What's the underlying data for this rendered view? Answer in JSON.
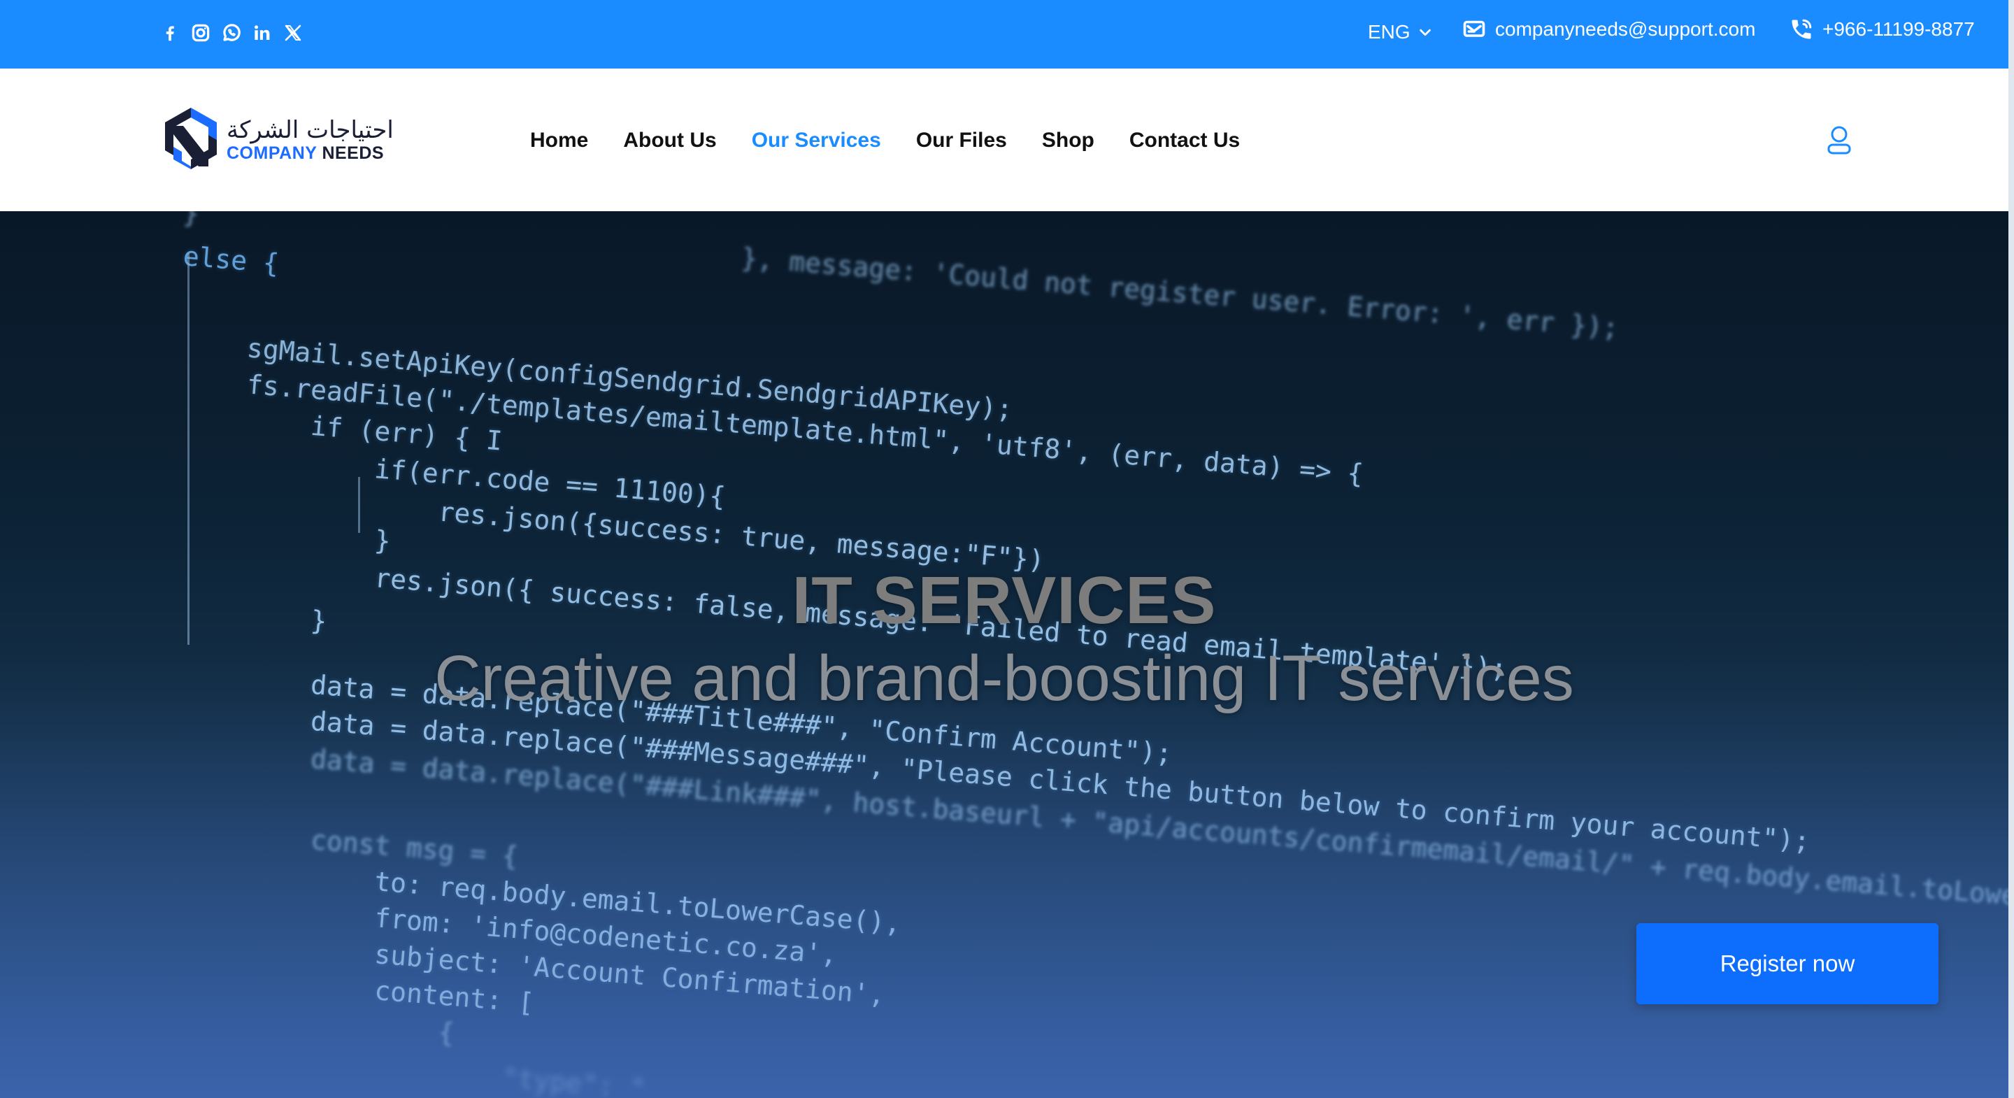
{
  "topbar": {
    "social_icons": [
      "facebook-icon",
      "instagram-icon",
      "whatsapp-icon",
      "linkedin-icon",
      "x-twitter-icon"
    ],
    "language": "ENG",
    "email": "companyneeds@support.com",
    "phone": "+966-11199-8877",
    "background_color": "#1b8cff"
  },
  "header": {
    "logo": {
      "arabic_text": "احتياجات الشركة",
      "company": "COMPANY",
      "needs": "NEEDS"
    },
    "nav": [
      {
        "label": "Home",
        "active": false
      },
      {
        "label": "About Us",
        "active": false
      },
      {
        "label": "Our Services",
        "active": true
      },
      {
        "label": "Our Files",
        "active": false
      },
      {
        "label": "Shop",
        "active": false
      },
      {
        "label": "Contact Us",
        "active": false
      }
    ],
    "accent_color": "#1b8cff"
  },
  "hero": {
    "title": "IT SERVICES",
    "subtitle": "Creative and brand-boosting IT services",
    "register_button": "Register now",
    "button_color": "#0d6efd",
    "code_lines": [
      "}                                  }, message: 'Could not register user. Error: ', err });",
      "else {",
      "    sgMail.setApiKey(configSendgrid.SendgridAPIKey);",
      "    fs.readFile(\"./templates/emailtemplate.html\", 'utf8', (err, data) => {",
      "        if (err) { I",
      "            if(err.code == 11100){",
      "                res.json({success: true, message:\"F\"})",
      "            }",
      "            res.json({ success: false, message: 'Failed to read email template' });",
      "        }",
      "        data = data.replace(\"###Title###\", \"Confirm Account\");",
      "        data = data.replace(\"###Message###\", \"Please click the button below to confirm your account\");",
      "        data = data.replace(\"###Link###\", host.baseurl + \"api/accounts/confirmemail/email/\" + req.body.email.toLowerCase());",
      "        const msg = {",
      "            to: req.body.email.toLowerCase(),",
      "            from: 'info@codenetic.co.za',",
      "            subject: 'Account Confirmation',",
      "            content: [",
      "                {",
      "                    \"type\": \""
    ]
  }
}
